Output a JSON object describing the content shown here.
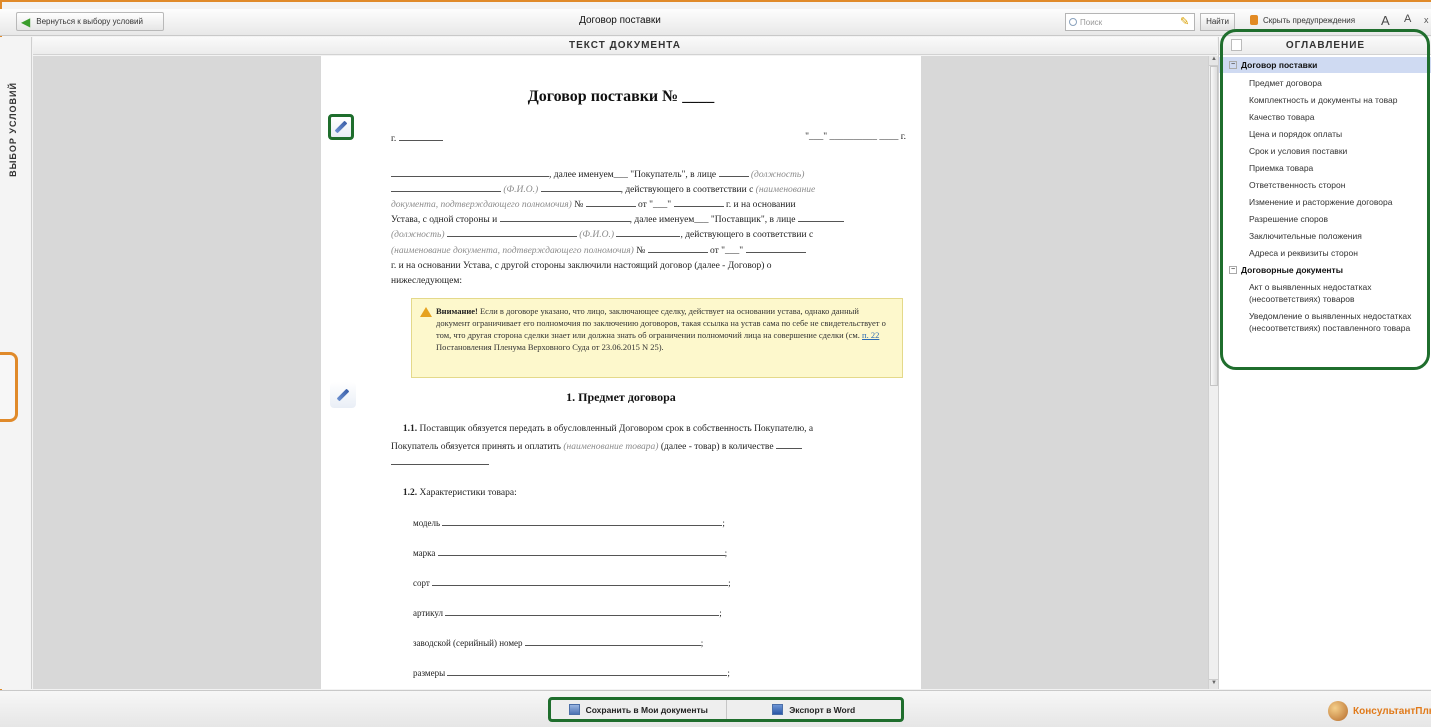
{
  "toolbar": {
    "back_label": "Вернуться к выбору условий",
    "title": "Договор поставки",
    "search_placeholder": "Поиск",
    "find_label": "Найти",
    "hide_warnings_label": "Скрыть предупреждения",
    "font_increase": "A",
    "font_decrease": "A",
    "close": "x"
  },
  "left_tab": {
    "label": "ВЫБОР УСЛОВИЙ"
  },
  "document": {
    "header": "ТЕКСТ ДОКУМЕНТА",
    "title": "Договор поставки № ____",
    "city_prefix": "г.",
    "date_suffix": "\"___\" __________ ____ г.",
    "p1_a": "далее именуем___ \"Покупатель\", в лице",
    "p1_hint_position": "(должность)",
    "p1_hint_fio": "(Ф.И.О.)",
    "p1_b": "действующего в соответствии с",
    "p1_hint_doc": "(наименование",
    "p1_hint_doc2": "документа, подтверждающего полномочия)",
    "p1_no": "№",
    "p1_from": "от \"___\"",
    "p1_c": "г. и на основании",
    "p1_d": "Устава, с одной стороны и",
    "p1_e": "далее именуем___ \"Поставщик\", в лице",
    "p1_hint_position2": "(должность)",
    "p1_hint_fio2": "(Ф.И.О.)",
    "p1_f": "действующего в соответствии с",
    "p1_hint_doc3": "(наименование документа, подтверждающего полномочия)",
    "p1_no2": "№",
    "p1_from2": "от \"___\"",
    "p1_g": "г. и на основании Устава, с другой стороны заключили настоящий договор (далее - Договор) о",
    "p1_h": "нижеследующем:",
    "warning_bold": "Внимание!",
    "warning_text": "Если в договоре указано, что лицо, заключающее сделку, действует на основании устава, однако данный документ ограничивает его полномочия по заключению договоров, такая ссылка на устав сама по себе не свидетельствует о том, что другая сторона сделки знает или должна знать об ограничении полномочий лица на совершение сделки (см.",
    "warning_link": "п. 22",
    "warning_tail": "Постановления Пленума Верховного Суда от 23.06.2015 N 25).",
    "section1_title": "1.  Предмет договора",
    "s11_num": "1.1.",
    "s11_text": "Поставщик обязуется передать в обусловленный Договором срок в собственность Покупателю, а",
    "s11_text2": "Покупатель обязуется принять и оплатить",
    "s11_hint": "(наименование товара)",
    "s11_text3": "(далее - товар) в количестве",
    "s12_num": "1.2.",
    "s12_text": "Характеристики товара:",
    "fields": [
      "модель",
      "марка",
      "сорт",
      "артикул",
      "заводской (серийный) номер",
      "размеры"
    ]
  },
  "toc": {
    "header": "ОГЛАВЛЕНИЕ",
    "items": [
      {
        "label": "Договор поставки",
        "level": "top",
        "selected": true
      },
      {
        "label": "Предмет договора",
        "level": "sub"
      },
      {
        "label": "Комплектность и документы на товар",
        "level": "sub"
      },
      {
        "label": "Качество товара",
        "level": "sub"
      },
      {
        "label": "Цена и порядок оплаты",
        "level": "sub"
      },
      {
        "label": "Срок и условия поставки",
        "level": "sub"
      },
      {
        "label": "Приемка товара",
        "level": "sub"
      },
      {
        "label": "Ответственность сторон",
        "level": "sub"
      },
      {
        "label": "Изменение и расторжение договора",
        "level": "sub"
      },
      {
        "label": "Разрешение споров",
        "level": "sub"
      },
      {
        "label": "Заключительные положения",
        "level": "sub"
      },
      {
        "label": "Адреса и реквизиты сторон",
        "level": "sub"
      },
      {
        "label": "Договорные документы",
        "level": "top"
      },
      {
        "label": "Акт о выявленных недостатках (несоответствиях) товаров",
        "level": "sub"
      },
      {
        "label": "Уведомление о выявленных недостатках (несоответствиях) поставленного товара",
        "level": "sub"
      }
    ]
  },
  "bottom": {
    "save_label": "Сохранить в Мои документы",
    "export_label": "Экспорт в Word",
    "brand": "КонсультантПлюс"
  },
  "colors": {
    "highlight_green": "#1f6e2d",
    "accent_orange": "#e08a2a",
    "warning_bg": "#fdf8cc",
    "toc_selected": "#cfdaf2"
  }
}
